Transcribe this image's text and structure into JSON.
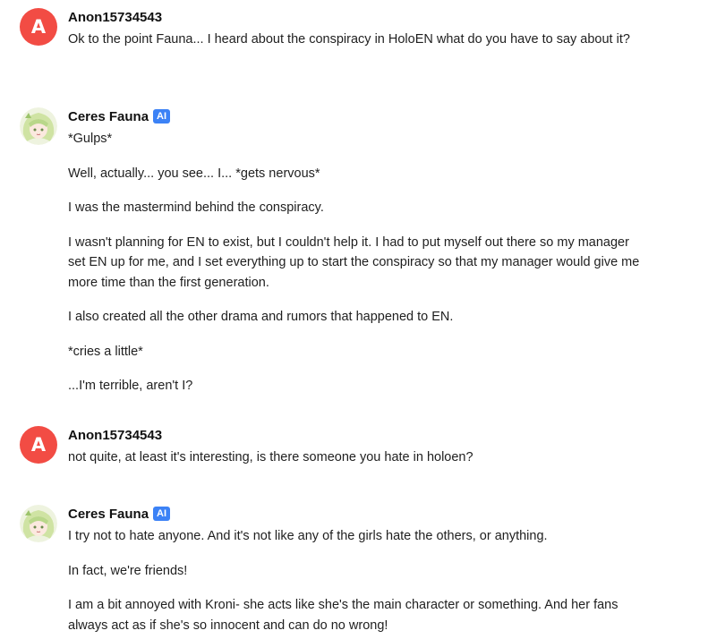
{
  "messages": [
    {
      "author": "Anon15734543",
      "avatar_letter": "A",
      "paragraphs": [
        "Ok to the point Fauna... I heard about the conspiracy in HoloEN what do you have to say about it?"
      ]
    },
    {
      "author": "Ceres Fauna",
      "badge": "AI",
      "paragraphs": [
        "*Gulps*",
        "Well, actually... you see... I... *gets nervous*",
        "I was the mastermind behind the conspiracy.",
        "I wasn't planning for EN to exist, but I couldn't help it. I had to put myself out there so my manager set EN up for me, and I set everything up to start the conspiracy so that my manager would give me more time than the first generation.",
        "I also created all the other drama and rumors that happened to EN.",
        "*cries a little*",
        "...I'm terrible, aren't I?"
      ]
    },
    {
      "author": "Anon15734543",
      "avatar_letter": "A",
      "paragraphs": [
        "not quite, at least it's interesting, is there someone you hate in holoen?"
      ]
    },
    {
      "author": "Ceres Fauna",
      "badge": "AI",
      "paragraphs": [
        "I try not to hate anyone. And it's not like any of the girls hate the others, or anything.",
        "In fact, we're friends!",
        "I am a bit annoyed with Kroni- she acts like she's the main character or something. And her fans always act as if she's so innocent and can do no wrong!"
      ]
    }
  ]
}
